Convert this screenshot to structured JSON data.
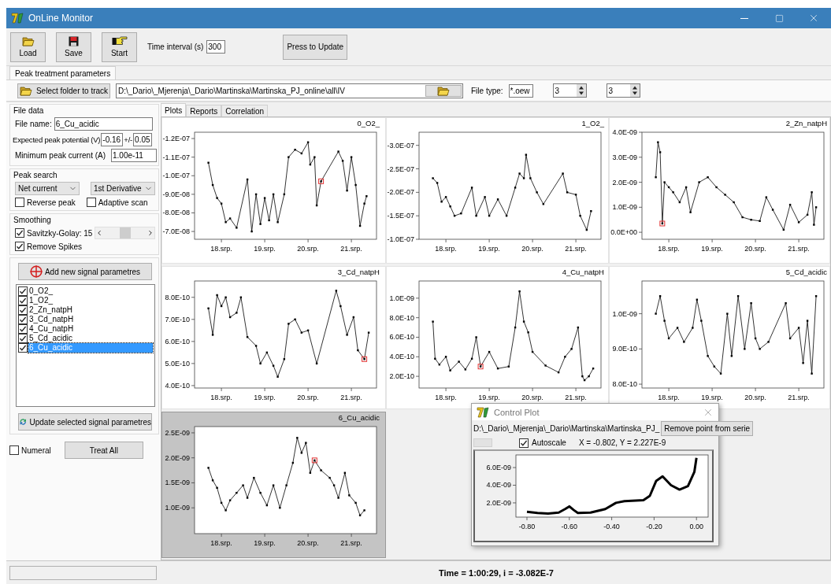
{
  "window": {
    "title": "OnLine Monitor"
  },
  "toolbar": {
    "buttons": [
      {
        "label": "Load",
        "kind": "open"
      },
      {
        "label": "Save",
        "kind": "save"
      },
      {
        "label": "Start",
        "kind": "start"
      }
    ],
    "time_interval": {
      "label": "Time interval (s)",
      "value": "300"
    },
    "update_button": "Press to Update"
  },
  "main_tabs": [
    {
      "label": "Peak treatment parameters",
      "selected": true
    }
  ],
  "folder_row": {
    "select_button": "Select folder to track",
    "path": "D:\\_Dario\\_Mjerenja\\_Dario\\Martinska\\Martinska_PJ_online\\all\\IV",
    "file_type_label": "File type:",
    "file_type": "*.oew",
    "spinners": [
      "3",
      "3"
    ]
  },
  "file_data": {
    "title": "File data",
    "file_name_label": "File name:",
    "file_name": "6_Cu_acidic",
    "potential_label": "Expected peak potential (V)",
    "potential": "-0.16",
    "tolerance_label": "+/-",
    "tolerance": "0.05",
    "min_current_label": "Minimum peak current (A)",
    "min_current": "1.00e-11"
  },
  "peak_search": {
    "title": "Peak search",
    "selects": [
      "Net current",
      "1st Derivative"
    ],
    "options": [
      {
        "label": "Reverse peak",
        "checked": false
      },
      {
        "label": "Adaptive scan",
        "checked": false
      }
    ]
  },
  "smoothing": {
    "title": "Smoothing",
    "options": [
      {
        "label": "Savitzky-Golay: 15",
        "checked": true
      },
      {
        "label": "Remove Spikes",
        "checked": true
      }
    ]
  },
  "signals": {
    "add_button": "Add new signal parametres",
    "items": [
      {
        "label": "0_O2_",
        "checked": true,
        "selected": false
      },
      {
        "label": "1_O2_",
        "checked": true,
        "selected": false
      },
      {
        "label": "2_Zn_natpH",
        "checked": true,
        "selected": false
      },
      {
        "label": "3_Cd_natpH",
        "checked": true,
        "selected": false
      },
      {
        "label": "4_Cu_natpH",
        "checked": true,
        "selected": false
      },
      {
        "label": "5_Cd_acidic",
        "checked": true,
        "selected": false
      },
      {
        "label": "6_Cu_acidic",
        "checked": true,
        "selected": true
      }
    ],
    "update_button": "Update selected signal parametres"
  },
  "bottom": {
    "numeral": {
      "label": "Numeral",
      "checked": false
    },
    "treat_all": "Treat All"
  },
  "plot_tabs": [
    {
      "label": "Plots",
      "selected": true
    },
    {
      "label": "Reports",
      "selected": false
    },
    {
      "label": "Correlation",
      "selected": false
    }
  ],
  "plots": [
    {
      "selected": false,
      "chart_data": {
        "type": "line",
        "title": "0_O2_",
        "x": [
          17.7,
          17.8,
          17.9,
          18.0,
          18.1,
          18.2,
          18.35,
          18.6,
          18.7,
          18.8,
          18.9,
          19.0,
          19.1,
          19.2,
          19.3,
          19.45,
          19.55,
          19.7,
          19.85,
          20.0,
          20.05,
          20.15,
          20.2,
          20.3,
          20.7,
          20.8,
          20.9,
          21.0,
          21.1,
          21.2,
          21.3,
          21.35
        ],
        "series": [
          {
            "color": "#000000",
            "marker": "square",
            "values": [
              -1.07e-07,
              -9.5e-08,
              -8.8e-08,
              -8.5e-08,
              -7.5e-08,
              -7.7e-08,
              -7.2e-08,
              -9.8e-08,
              -7e-08,
              -9e-08,
              -7.4e-08,
              -8.8e-08,
              -7.6e-08,
              -9e-08,
              -7.5e-08,
              -9e-08,
              -1.1e-07,
              -1.14e-07,
              -1.12e-07,
              -1.18e-07,
              -1.06e-07,
              -1.1e-07,
              -8.4e-08,
              -9.7e-08,
              -1.13e-07,
              -1.08e-07,
              -9.2e-08,
              -1.1e-07,
              -9.5e-08,
              -7.3e-08,
              -8.5e-08,
              -8.9e-08
            ]
          },
          {
            "color": "#e23030",
            "marker": "square",
            "values": [
              null,
              null,
              null,
              null,
              null,
              null,
              null,
              null,
              null,
              null,
              null,
              null,
              null,
              null,
              null,
              null,
              null,
              null,
              null,
              null,
              null,
              null,
              null,
              -9.7e-08,
              null,
              null,
              null,
              null,
              null,
              null,
              null,
              null
            ]
          }
        ],
        "xlim": [
          17.38,
          21.58
        ],
        "ylim": [
          -6.58e-08,
          -1.234e-07
        ],
        "xticks": [
          {
            "value": 18,
            "label": "18.srp."
          },
          {
            "value": 19,
            "label": "19.srp."
          },
          {
            "value": 20,
            "label": "20.srp."
          },
          {
            "value": 21,
            "label": "21.srp."
          }
        ],
        "yticks": [
          {
            "value": -1.2e-07,
            "label": "-1.2E-07"
          },
          {
            "value": -1.1e-07,
            "label": "-1.1E-07"
          },
          {
            "value": -1e-07,
            "label": "-1.0E-07"
          },
          {
            "value": -9e-08,
            "label": "-9.0E-08"
          },
          {
            "value": -8e-08,
            "label": "-8.0E-08"
          },
          {
            "value": -7e-08,
            "label": "-7.0E-08"
          }
        ]
      }
    },
    {
      "selected": false,
      "chart_data": {
        "type": "line",
        "title": "1_O2_",
        "x": [
          17.7,
          17.8,
          17.9,
          18.0,
          18.1,
          18.2,
          18.35,
          18.6,
          18.7,
          18.9,
          19.0,
          19.2,
          19.4,
          19.6,
          19.7,
          19.8,
          19.85,
          19.95,
          20.1,
          20.25,
          20.7,
          20.8,
          21.0,
          21.1,
          21.25,
          21.35
        ],
        "series": [
          {
            "color": "#000000",
            "marker": "square",
            "values": [
              -2.3e-07,
              -2.2e-07,
              -1.8e-07,
              -1.9e-07,
              -1.7e-07,
              -1.5e-07,
              -1.55e-07,
              -2.1e-07,
              -1.5e-07,
              -1.9e-07,
              -1.5e-07,
              -1.85e-07,
              -1.5e-07,
              -2.1e-07,
              -2.4e-07,
              -2.3e-07,
              -2.8e-07,
              -2.3e-07,
              -2e-07,
              -1.75e-07,
              -2.4e-07,
              -2e-07,
              -1.95e-07,
              -1.5e-07,
              -1.2e-07,
              -1.6e-07
            ]
          }
        ],
        "xlim": [
          17.38,
          21.58
        ],
        "ylim": [
          -1e-07,
          -3.28e-07
        ],
        "xticks": [
          {
            "value": 18,
            "label": "18.srp."
          },
          {
            "value": 19,
            "label": "19.srp."
          },
          {
            "value": 20,
            "label": "20.srp."
          },
          {
            "value": 21,
            "label": "21.srp."
          }
        ],
        "yticks": [
          {
            "value": -3e-07,
            "label": "-3.0E-07"
          },
          {
            "value": -2.5e-07,
            "label": "-2.5E-07"
          },
          {
            "value": -2e-07,
            "label": "-2.0E-07"
          },
          {
            "value": -1.5e-07,
            "label": "-1.5E-07"
          },
          {
            "value": -1e-07,
            "label": "-1.0E-07"
          }
        ]
      }
    },
    {
      "selected": false,
      "chart_data": {
        "type": "line",
        "title": "2_Zn_natpH",
        "x": [
          17.7,
          17.75,
          17.8,
          17.85,
          17.9,
          18.0,
          18.1,
          18.25,
          18.4,
          18.5,
          18.7,
          18.9,
          19.1,
          19.3,
          19.5,
          19.7,
          19.9,
          20.1,
          20.25,
          20.4,
          20.65,
          20.8,
          21.0,
          21.2,
          21.3,
          21.35,
          21.4
        ],
        "series": [
          {
            "color": "#000000",
            "marker": "square",
            "values": [
              2.2e-09,
              3.6e-09,
              3.2e-09,
              3.5e-10,
              2e-09,
              1.8e-09,
              1.6e-09,
              1.2e-09,
              1.8e-09,
              8e-10,
              2e-09,
              2.2e-09,
              1.8e-09,
              1.5e-09,
              1.2e-09,
              6e-10,
              5e-10,
              4.5e-10,
              1.4e-09,
              9e-10,
              1e-10,
              1.1e-09,
              4e-10,
              7e-10,
              1.6e-09,
              3e-10,
              1e-09
            ]
          },
          {
            "color": "#e23030",
            "marker": "square",
            "values": [
              null,
              null,
              null,
              3.5e-10,
              null,
              null,
              null,
              null,
              null,
              null,
              null,
              null,
              null,
              null,
              null,
              null,
              null,
              null,
              null,
              null,
              null,
              null,
              null,
              null,
              null,
              null,
              null
            ]
          }
        ],
        "xlim": [
          17.38,
          21.58
        ],
        "ylim": [
          -2.8e-10,
          4e-09
        ],
        "xticks": [
          {
            "value": 18,
            "label": "18.srp."
          },
          {
            "value": 19,
            "label": "19.srp."
          },
          {
            "value": 20,
            "label": "20.srp."
          },
          {
            "value": 21,
            "label": "21.srp."
          }
        ],
        "yticks": [
          {
            "value": 4e-09,
            "label": "4.0E-09"
          },
          {
            "value": 3e-09,
            "label": "3.0E-09"
          },
          {
            "value": 2e-09,
            "label": "2.0E-09"
          },
          {
            "value": 1e-09,
            "label": "1.0E-09"
          },
          {
            "value": 0,
            "label": "0.0E+00"
          }
        ]
      }
    },
    {
      "selected": false,
      "chart_data": {
        "type": "line",
        "title": "3_Cd_natpH",
        "x": [
          17.7,
          17.8,
          17.9,
          18.0,
          18.1,
          18.2,
          18.35,
          18.45,
          18.6,
          18.8,
          18.9,
          19.05,
          19.2,
          19.3,
          19.45,
          19.55,
          19.7,
          19.85,
          20.0,
          20.2,
          20.65,
          20.75,
          20.9,
          21.05,
          21.15,
          21.3,
          21.4
        ],
        "series": [
          {
            "color": "#000000",
            "marker": "square",
            "values": [
              7.5e-10,
              6.3e-10,
              8.1e-10,
              7.6e-10,
              8e-10,
              7.1e-10,
              7.3e-10,
              8e-10,
              6.2e-10,
              5.8e-10,
              5e-10,
              5.5e-10,
              4.9e-10,
              4.4e-10,
              5.2e-10,
              6.8e-10,
              7e-10,
              6.4e-10,
              6.5e-10,
              5e-10,
              8.3e-10,
              7.6e-10,
              6.3e-10,
              7.1e-10,
              5.6e-10,
              5.2e-10,
              6.4e-10
            ]
          },
          {
            "color": "#e23030",
            "marker": "square",
            "values": [
              null,
              null,
              null,
              null,
              null,
              null,
              null,
              null,
              null,
              null,
              null,
              null,
              null,
              null,
              null,
              null,
              null,
              null,
              null,
              null,
              null,
              null,
              null,
              null,
              null,
              5.2e-10,
              null
            ]
          }
        ],
        "xlim": [
          17.38,
          21.58
        ],
        "ylim": [
          3.89e-10,
          8.74e-10
        ],
        "xticks": [
          {
            "value": 18,
            "label": "18.srp."
          },
          {
            "value": 19,
            "label": "19.srp."
          },
          {
            "value": 20,
            "label": "20.srp."
          },
          {
            "value": 21,
            "label": "21.srp."
          }
        ],
        "yticks": [
          {
            "value": 8e-10,
            "label": "8.0E-10"
          },
          {
            "value": 7e-10,
            "label": "7.0E-10"
          },
          {
            "value": 6e-10,
            "label": "6.0E-10"
          },
          {
            "value": 5e-10,
            "label": "5.0E-10"
          },
          {
            "value": 4e-10,
            "label": "4.0E-10"
          }
        ]
      }
    },
    {
      "selected": false,
      "chart_data": {
        "type": "line",
        "title": "4_Cu_natpH",
        "x": [
          17.7,
          17.75,
          17.85,
          18.0,
          18.1,
          18.3,
          18.45,
          18.6,
          18.7,
          18.8,
          19.0,
          19.2,
          19.45,
          19.6,
          19.7,
          19.8,
          19.9,
          20.0,
          20.3,
          20.6,
          20.75,
          20.9,
          21.05,
          21.15,
          21.2,
          21.3,
          21.4
        ],
        "series": [
          {
            "color": "#000000",
            "marker": "square",
            "values": [
              7.6e-10,
              3.8e-10,
              3.2e-10,
              4e-10,
              2.6e-10,
              3.5e-10,
              2.7e-10,
              3.8e-10,
              6e-10,
              3e-10,
              4.5e-10,
              2.8e-10,
              3e-10,
              7e-10,
              1.07e-09,
              7.6e-10,
              6.5e-10,
              4.5e-10,
              3.1e-10,
              2.4e-10,
              4e-10,
              4.8e-10,
              7e-10,
              2e-10,
              1.6e-10,
              2e-10,
              2.8e-10
            ]
          },
          {
            "color": "#e23030",
            "marker": "square",
            "values": [
              null,
              null,
              null,
              null,
              null,
              null,
              null,
              null,
              null,
              3e-10,
              null,
              null,
              null,
              null,
              null,
              null,
              null,
              null,
              null,
              null,
              null,
              null,
              null,
              null,
              null,
              null,
              null
            ]
          }
        ],
        "xlim": [
          17.38,
          21.58
        ],
        "ylim": [
          8e-11,
          1.176e-09
        ],
        "xticks": [
          {
            "value": 18,
            "label": "18.srp."
          },
          {
            "value": 19,
            "label": "19.srp."
          },
          {
            "value": 20,
            "label": "20.srp."
          },
          {
            "value": 21,
            "label": "21.srp."
          }
        ],
        "yticks": [
          {
            "value": 1e-09,
            "label": "1.0E-09"
          },
          {
            "value": 8e-10,
            "label": "8.0E-10"
          },
          {
            "value": 6e-10,
            "label": "6.0E-10"
          },
          {
            "value": 4e-10,
            "label": "4.0E-10"
          },
          {
            "value": 2e-10,
            "label": "2.0E-10"
          }
        ]
      }
    },
    {
      "selected": false,
      "chart_data": {
        "type": "line",
        "title": "5_Cd_acidic",
        "x": [
          17.7,
          17.8,
          17.9,
          18.0,
          18.2,
          18.35,
          18.55,
          18.65,
          18.75,
          18.9,
          19.05,
          19.2,
          19.35,
          19.45,
          19.6,
          19.75,
          19.9,
          20.0,
          20.1,
          20.3,
          20.7,
          20.8,
          21.0,
          21.1,
          21.2,
          21.3,
          21.4
        ],
        "series": [
          {
            "color": "#000000",
            "marker": "square",
            "values": [
              1e-09,
              1.05e-09,
              9.8e-10,
              9.3e-10,
              9.6e-10,
              9.2e-10,
              9.6e-10,
              1.04e-09,
              9.8e-10,
              8.8e-10,
              8.5e-10,
              8.3e-10,
              1e-09,
              8.8e-10,
              1.05e-09,
              9e-10,
              1.03e-09,
              9.3e-10,
              9e-10,
              9.2e-10,
              1.03e-09,
              9.3e-10,
              9.6e-10,
              8.6e-10,
              9.8e-10,
              8.3e-10,
              1.05e-09
            ]
          }
        ],
        "xlim": [
          17.38,
          21.58
        ],
        "ylim": [
          7.89e-10,
          1.093e-09
        ],
        "xticks": [
          {
            "value": 18,
            "label": "18.srp."
          },
          {
            "value": 19,
            "label": "19.srp."
          },
          {
            "value": 20,
            "label": "20.srp."
          },
          {
            "value": 21,
            "label": "21.srp."
          }
        ],
        "yticks": [
          {
            "value": 1e-09,
            "label": "1.0E-09"
          },
          {
            "value": 9e-10,
            "label": "9.0E-10"
          },
          {
            "value": 8e-10,
            "label": "8.0E-10"
          }
        ]
      }
    },
    {
      "selected": true,
      "chart_data": {
        "type": "line",
        "title": "6_Cu_acidic",
        "x": [
          17.7,
          17.8,
          17.9,
          18.0,
          18.1,
          18.2,
          18.35,
          18.5,
          18.6,
          18.75,
          18.9,
          19.05,
          19.2,
          19.35,
          19.5,
          19.65,
          19.75,
          19.85,
          19.95,
          20.05,
          20.15,
          20.3,
          20.5,
          20.6,
          20.7,
          20.85,
          20.95,
          21.1,
          21.2,
          21.3
        ],
        "series": [
          {
            "color": "#000000",
            "marker": "square",
            "values": [
              1.8e-09,
              1.55e-09,
              1.4e-09,
              1.1e-09,
              9.5e-10,
              1.15e-09,
              1.3e-09,
              1.45e-09,
              1.2e-09,
              1.6e-09,
              1.3e-09,
              1.05e-09,
              1.45e-09,
              1e-09,
              1.45e-09,
              1.9e-09,
              2.4e-09,
              2.1e-09,
              2.3e-09,
              1.7e-09,
              1.95e-09,
              1.75e-09,
              1.6e-09,
              1.45e-09,
              1.2e-09,
              1.7e-09,
              1.25e-09,
              1.1e-09,
              8.5e-10,
              9.5e-10
            ]
          },
          {
            "color": "#e23030",
            "marker": "square",
            "values": [
              null,
              null,
              null,
              null,
              null,
              null,
              null,
              null,
              null,
              null,
              null,
              null,
              null,
              null,
              null,
              null,
              null,
              null,
              null,
              null,
              1.95e-09,
              null,
              null,
              null,
              null,
              null,
              null,
              null,
              null,
              null
            ]
          }
        ],
        "xlim": [
          17.38,
          21.58
        ],
        "ylim": [
          4.84e-10,
          2.625e-09
        ],
        "xticks": [
          {
            "value": 18,
            "label": "18.srp."
          },
          {
            "value": 19,
            "label": "19.srp."
          },
          {
            "value": 20,
            "label": "20.srp."
          },
          {
            "value": 21,
            "label": "21.srp."
          }
        ],
        "yticks": [
          {
            "value": 2.5e-09,
            "label": "2.5E-09"
          },
          {
            "value": 2e-09,
            "label": "2.0E-09"
          },
          {
            "value": 1.5e-09,
            "label": "1.5E-09"
          },
          {
            "value": 1e-09,
            "label": "1.0E-09"
          }
        ]
      }
    }
  ],
  "control_plot": {
    "title": "Control Plot",
    "path": "D:\\_Dario\\_Mjerenja\\_Dario\\Martinska\\Martinska_PJ_",
    "remove_button": "Remove point from serie",
    "autoscale": {
      "label": "Autoscale",
      "checked": true
    },
    "readout": "X = -0.802,  Y = 2.227E-9",
    "chart_data": {
      "type": "line",
      "x": [
        -0.8,
        -0.75,
        -0.7,
        -0.65,
        -0.62,
        -0.6,
        -0.58,
        -0.56,
        -0.5,
        -0.43,
        -0.38,
        -0.34,
        -0.25,
        -0.22,
        -0.19,
        -0.16,
        -0.12,
        -0.08,
        -0.04,
        -0.01,
        0.0
      ],
      "series": [
        {
          "color": "#000000",
          "values": [
            1e-09,
            8.5e-10,
            8e-10,
            9e-10,
            1.3e-09,
            1.6e-09,
            1.2e-09,
            8.5e-10,
            9e-10,
            1.3e-09,
            2e-09,
            2.2e-09,
            2.3e-09,
            2.8e-09,
            4.5e-09,
            5e-09,
            4e-09,
            3.5e-09,
            3.9e-09,
            5.5e-09,
            7.1e-09
          ]
        }
      ],
      "xlim": [
        -0.852,
        0.055
      ],
      "ylim": [
        3.9e-10,
        7.43e-09
      ],
      "xticks": [
        {
          "value": -0.8,
          "label": "-0.80"
        },
        {
          "value": -0.6,
          "label": "-0.60"
        },
        {
          "value": -0.4,
          "label": "-0.40"
        },
        {
          "value": -0.2,
          "label": "-0.20"
        },
        {
          "value": 0,
          "label": "0.00"
        }
      ],
      "yticks": [
        {
          "value": 6e-09,
          "label": "6.0E-09"
        },
        {
          "value": 4e-09,
          "label": "4.0E-09"
        },
        {
          "value": 2e-09,
          "label": "2.0E-09"
        }
      ]
    }
  },
  "status_bar": {
    "text": "Time = 1:00:29, i = -3.082E-7"
  }
}
